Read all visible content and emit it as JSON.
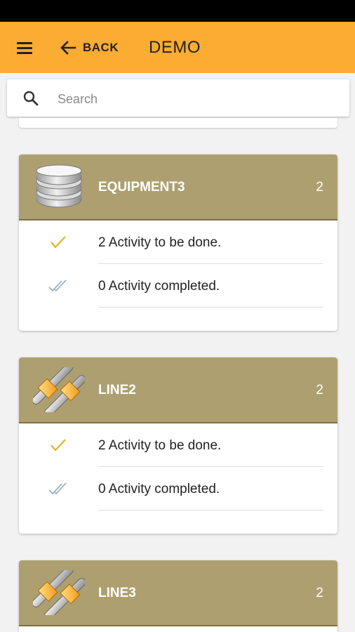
{
  "appbar": {
    "back_label": "BACK",
    "title": "DEMO"
  },
  "search": {
    "placeholder": "Search",
    "value": ""
  },
  "cards": [
    {
      "title": "EQUIPMENT3",
      "count": "2",
      "icon": "database-icon",
      "rows": [
        {
          "icon": "check-icon",
          "text": "2 Activity to be done."
        },
        {
          "icon": "double-check-icon",
          "text": "0 Activity completed."
        }
      ]
    },
    {
      "title": "LINE2",
      "count": "2",
      "icon": "line-icon",
      "rows": [
        {
          "icon": "check-icon",
          "text": "2 Activity to be done."
        },
        {
          "icon": "double-check-icon",
          "text": "0 Activity completed."
        }
      ]
    },
    {
      "title": "LINE3",
      "count": "2",
      "icon": "line-icon",
      "rows": []
    }
  ],
  "colors": {
    "appbar": "#fbac33",
    "card_header": "#ad9f6f",
    "check": "#e0b42a",
    "double_check": "#9fb1c4"
  }
}
